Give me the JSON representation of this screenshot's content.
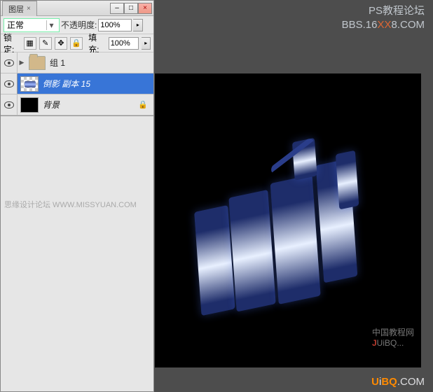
{
  "panel": {
    "tab_title": "图层",
    "blend_label_select": "正常",
    "opacity_label": "不透明度:",
    "opacity_value": "100%",
    "lock_label": "锁定:",
    "fill_label": "填充:",
    "fill_value": "100%"
  },
  "layers": [
    {
      "name": "组 1",
      "type": "group",
      "visible": true
    },
    {
      "name": "倒影 副本 15",
      "type": "layer",
      "visible": true,
      "selected": true
    },
    {
      "name": "背景",
      "type": "bg",
      "visible": true,
      "locked": true
    }
  ],
  "watermarks": {
    "siyan": "思缘设计论坛  WWW.MISSYUAN.COM",
    "top_line1": "PS教程论坛",
    "top_line2_a": "BBS.16",
    "top_line2_hl": "XX",
    "top_line2_b": "8.COM",
    "cn_tut": "中国教程网",
    "juibq_j": "J",
    "juibq_rest": "UiBQ...",
    "uibq_u": "U",
    "uibq_i": "i",
    "uibq_b": "B",
    "uibq_q": "Q",
    "uibq_com": ".COM"
  }
}
